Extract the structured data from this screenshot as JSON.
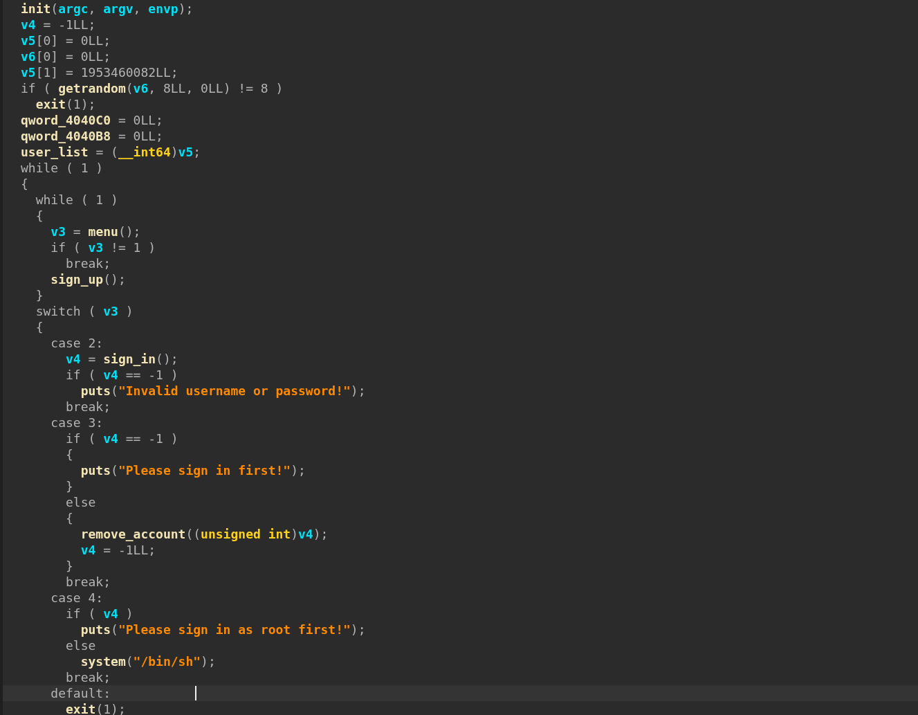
{
  "editor": {
    "lines": [
      {
        "current": false,
        "tokens": [
          {
            "kind": "fn",
            "text": "init"
          },
          {
            "kind": "op",
            "text": "("
          },
          {
            "kind": "var",
            "text": "argc"
          },
          {
            "kind": "op",
            "text": ", "
          },
          {
            "kind": "var",
            "text": "argv"
          },
          {
            "kind": "op",
            "text": ", "
          },
          {
            "kind": "var",
            "text": "envp"
          },
          {
            "kind": "op",
            "text": ");"
          }
        ]
      },
      {
        "current": false,
        "tokens": [
          {
            "kind": "var",
            "text": "v4"
          },
          {
            "kind": "op",
            "text": " = -1LL;"
          }
        ]
      },
      {
        "current": false,
        "tokens": [
          {
            "kind": "var",
            "text": "v5"
          },
          {
            "kind": "op",
            "text": "[0] = 0LL;"
          }
        ]
      },
      {
        "current": false,
        "tokens": [
          {
            "kind": "var",
            "text": "v6"
          },
          {
            "kind": "op",
            "text": "[0] = 0LL;"
          }
        ]
      },
      {
        "current": false,
        "tokens": [
          {
            "kind": "var",
            "text": "v5"
          },
          {
            "kind": "op",
            "text": "[1] = 1953460082LL;"
          }
        ]
      },
      {
        "current": false,
        "tokens": [
          {
            "kind": "op",
            "text": "if ( "
          },
          {
            "kind": "fn",
            "text": "getrandom"
          },
          {
            "kind": "op",
            "text": "("
          },
          {
            "kind": "var",
            "text": "v6"
          },
          {
            "kind": "op",
            "text": ", 8LL, 0LL) != 8 )"
          }
        ]
      },
      {
        "current": false,
        "tokens": [
          {
            "kind": "fn",
            "text": "  exit"
          },
          {
            "kind": "op",
            "text": "(1);"
          }
        ]
      },
      {
        "current": false,
        "tokens": [
          {
            "kind": "fn",
            "text": "qword_4040C0"
          },
          {
            "kind": "op",
            "text": " = 0LL;"
          }
        ]
      },
      {
        "current": false,
        "tokens": [
          {
            "kind": "fn",
            "text": "qword_4040B8"
          },
          {
            "kind": "op",
            "text": " = 0LL;"
          }
        ]
      },
      {
        "current": false,
        "tokens": [
          {
            "kind": "fn",
            "text": "user_list"
          },
          {
            "kind": "op",
            "text": " = ("
          },
          {
            "kind": "type",
            "text": "__int64"
          },
          {
            "kind": "op",
            "text": ")"
          },
          {
            "kind": "var",
            "text": "v5"
          },
          {
            "kind": "op",
            "text": ";"
          }
        ]
      },
      {
        "current": false,
        "tokens": [
          {
            "kind": "op",
            "text": "while ( 1 )"
          }
        ]
      },
      {
        "current": false,
        "tokens": [
          {
            "kind": "op",
            "text": "{"
          }
        ]
      },
      {
        "current": false,
        "tokens": [
          {
            "kind": "op",
            "text": "  while ( 1 )"
          }
        ]
      },
      {
        "current": false,
        "tokens": [
          {
            "kind": "op",
            "text": "  {"
          }
        ]
      },
      {
        "current": false,
        "tokens": [
          {
            "kind": "var",
            "text": "    v3"
          },
          {
            "kind": "op",
            "text": " = "
          },
          {
            "kind": "fn",
            "text": "menu"
          },
          {
            "kind": "op",
            "text": "();"
          }
        ]
      },
      {
        "current": false,
        "tokens": [
          {
            "kind": "op",
            "text": "    if ( "
          },
          {
            "kind": "var",
            "text": "v3"
          },
          {
            "kind": "op",
            "text": " != 1 )"
          }
        ]
      },
      {
        "current": false,
        "tokens": [
          {
            "kind": "op",
            "text": "      break;"
          }
        ]
      },
      {
        "current": false,
        "tokens": [
          {
            "kind": "fn",
            "text": "    sign_up"
          },
          {
            "kind": "op",
            "text": "();"
          }
        ]
      },
      {
        "current": false,
        "tokens": [
          {
            "kind": "op",
            "text": "  }"
          }
        ]
      },
      {
        "current": false,
        "tokens": [
          {
            "kind": "op",
            "text": "  switch ( "
          },
          {
            "kind": "var",
            "text": "v3"
          },
          {
            "kind": "op",
            "text": " )"
          }
        ]
      },
      {
        "current": false,
        "tokens": [
          {
            "kind": "op",
            "text": "  {"
          }
        ]
      },
      {
        "current": false,
        "tokens": [
          {
            "kind": "op",
            "text": "    case 2:"
          }
        ]
      },
      {
        "current": false,
        "tokens": [
          {
            "kind": "var",
            "text": "      v4"
          },
          {
            "kind": "op",
            "text": " = "
          },
          {
            "kind": "fn",
            "text": "sign_in"
          },
          {
            "kind": "op",
            "text": "();"
          }
        ]
      },
      {
        "current": false,
        "tokens": [
          {
            "kind": "op",
            "text": "      if ( "
          },
          {
            "kind": "var",
            "text": "v4"
          },
          {
            "kind": "op",
            "text": " == -1 )"
          }
        ]
      },
      {
        "current": false,
        "tokens": [
          {
            "kind": "fn",
            "text": "        puts"
          },
          {
            "kind": "op",
            "text": "("
          },
          {
            "kind": "str",
            "text": "\"Invalid username or password!\""
          },
          {
            "kind": "op",
            "text": ");"
          }
        ]
      },
      {
        "current": false,
        "tokens": [
          {
            "kind": "op",
            "text": "      break;"
          }
        ]
      },
      {
        "current": false,
        "tokens": [
          {
            "kind": "op",
            "text": "    case 3:"
          }
        ]
      },
      {
        "current": false,
        "tokens": [
          {
            "kind": "op",
            "text": "      if ( "
          },
          {
            "kind": "var",
            "text": "v4"
          },
          {
            "kind": "op",
            "text": " == -1 )"
          }
        ]
      },
      {
        "current": false,
        "tokens": [
          {
            "kind": "op",
            "text": "      {"
          }
        ]
      },
      {
        "current": false,
        "tokens": [
          {
            "kind": "fn",
            "text": "        puts"
          },
          {
            "kind": "op",
            "text": "("
          },
          {
            "kind": "str",
            "text": "\"Please sign in first!\""
          },
          {
            "kind": "op",
            "text": ");"
          }
        ]
      },
      {
        "current": false,
        "tokens": [
          {
            "kind": "op",
            "text": "      }"
          }
        ]
      },
      {
        "current": false,
        "tokens": [
          {
            "kind": "op",
            "text": "      else"
          }
        ]
      },
      {
        "current": false,
        "tokens": [
          {
            "kind": "op",
            "text": "      {"
          }
        ]
      },
      {
        "current": false,
        "tokens": [
          {
            "kind": "fn",
            "text": "        remove_account"
          },
          {
            "kind": "op",
            "text": "(("
          },
          {
            "kind": "type",
            "text": "unsigned int"
          },
          {
            "kind": "op",
            "text": ")"
          },
          {
            "kind": "var",
            "text": "v4"
          },
          {
            "kind": "op",
            "text": ");"
          }
        ]
      },
      {
        "current": false,
        "tokens": [
          {
            "kind": "var",
            "text": "        v4"
          },
          {
            "kind": "op",
            "text": " = -1LL;"
          }
        ]
      },
      {
        "current": false,
        "tokens": [
          {
            "kind": "op",
            "text": "      }"
          }
        ]
      },
      {
        "current": false,
        "tokens": [
          {
            "kind": "op",
            "text": "      break;"
          }
        ]
      },
      {
        "current": false,
        "tokens": [
          {
            "kind": "op",
            "text": "    case 4:"
          }
        ]
      },
      {
        "current": false,
        "tokens": [
          {
            "kind": "op",
            "text": "      if ( "
          },
          {
            "kind": "var",
            "text": "v4"
          },
          {
            "kind": "op",
            "text": " )"
          }
        ]
      },
      {
        "current": false,
        "tokens": [
          {
            "kind": "fn",
            "text": "        puts"
          },
          {
            "kind": "op",
            "text": "("
          },
          {
            "kind": "str",
            "text": "\"Please sign in as root first!\""
          },
          {
            "kind": "op",
            "text": ");"
          }
        ]
      },
      {
        "current": false,
        "tokens": [
          {
            "kind": "op",
            "text": "      else"
          }
        ]
      },
      {
        "current": false,
        "tokens": [
          {
            "kind": "fn",
            "text": "        system"
          },
          {
            "kind": "op",
            "text": "("
          },
          {
            "kind": "str",
            "text": "\"/bin/sh\""
          },
          {
            "kind": "op",
            "text": ");"
          }
        ]
      },
      {
        "current": false,
        "tokens": [
          {
            "kind": "op",
            "text": "      break;"
          }
        ]
      },
      {
        "current": true,
        "tokens": [
          {
            "kind": "op",
            "text": "    default:"
          }
        ]
      },
      {
        "current": false,
        "tokens": [
          {
            "kind": "fn",
            "text": "      exit"
          },
          {
            "kind": "op",
            "text": "(1);"
          }
        ]
      }
    ]
  }
}
